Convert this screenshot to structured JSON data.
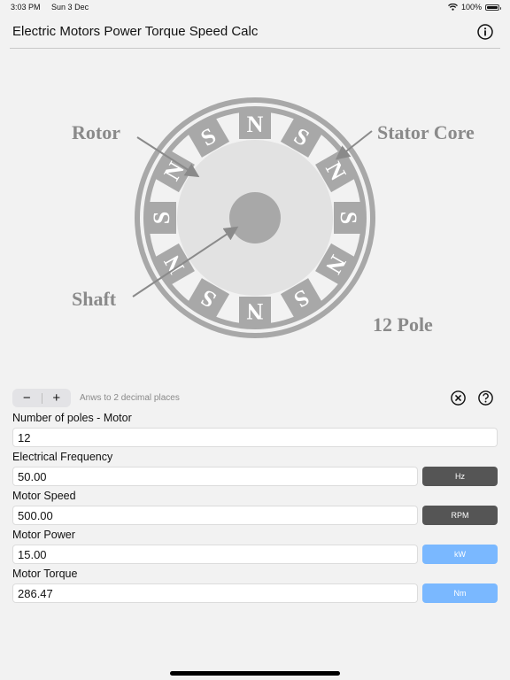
{
  "status_bar": {
    "time": "3:03 PM",
    "date": "Sun 3 Dec",
    "battery": "100%",
    "battery_level": 1.0
  },
  "header": {
    "title": "Electric Motors Power Torque Speed Calc",
    "info_icon": "info-circle-icon"
  },
  "diagram": {
    "rotor_label": "Rotor",
    "stator_label": "Stator Core",
    "shaft_label": "Shaft",
    "poles_label": "12 Pole",
    "magnets": [
      "N",
      "S",
      "N",
      "S",
      "N",
      "S",
      "N",
      "S",
      "N",
      "S",
      "N",
      "S"
    ]
  },
  "controls": {
    "decrement": "−",
    "increment": "+",
    "hint": "Anws to 2 decimal places",
    "clear_icon": "clear-circle-icon",
    "help_icon": "help-circle-icon"
  },
  "fields": {
    "poles": {
      "label": "Number of poles - Motor",
      "value": "12"
    },
    "frequency": {
      "label": "Electrical Frequency",
      "value": "50.00",
      "unit": "Hz"
    },
    "speed": {
      "label": "Motor Speed",
      "value": "500.00",
      "unit": "RPM"
    },
    "power": {
      "label": "Motor Power",
      "value": "15.00",
      "unit": "kW"
    },
    "torque": {
      "label": "Motor Torque",
      "value": "286.47",
      "unit": "Nm"
    }
  },
  "colors": {
    "background": "#f2f2f2",
    "diagram_gray": "#a8a8a8",
    "unit_dark": "#555555",
    "unit_blue": "#7ab8ff"
  }
}
